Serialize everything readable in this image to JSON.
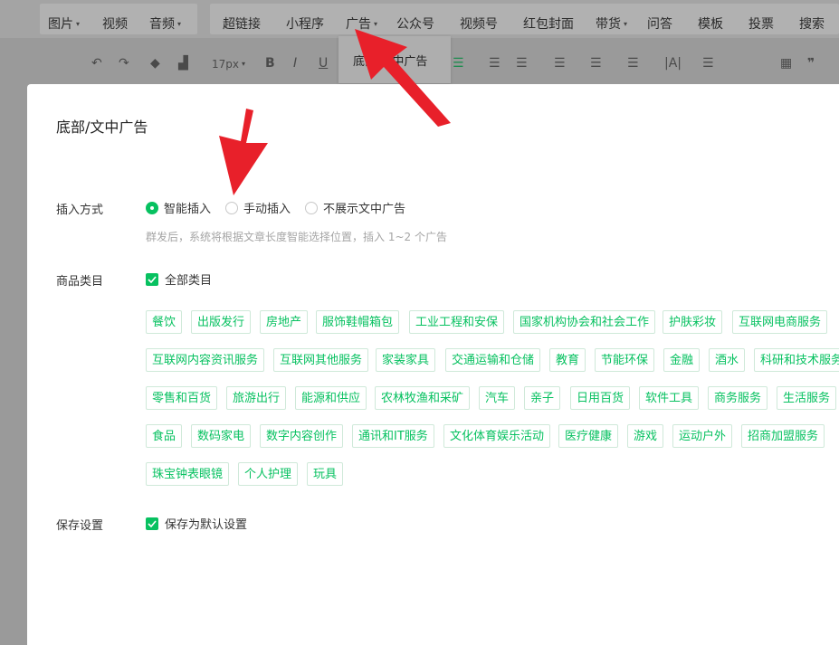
{
  "menubar": {
    "left_items": [
      {
        "label": "图片",
        "caret": true
      },
      {
        "label": "视频",
        "caret": false
      },
      {
        "label": "音频",
        "caret": true
      }
    ],
    "right_items": [
      {
        "label": "超链接",
        "caret": false
      },
      {
        "label": "小程序",
        "caret": false
      },
      {
        "label": "广告",
        "caret": true
      },
      {
        "label": "公众号",
        "caret": false
      },
      {
        "label": "视频号",
        "caret": false
      },
      {
        "label": "红包封面",
        "caret": false
      },
      {
        "label": "带货",
        "caret": true
      },
      {
        "label": "问答",
        "caret": false
      },
      {
        "label": "模板",
        "caret": false
      },
      {
        "label": "投票",
        "caret": false
      },
      {
        "label": "搜索",
        "caret": false
      }
    ]
  },
  "dropdown": {
    "item": "底部/文中广告"
  },
  "toolbar": {
    "font_size": "17px"
  },
  "modal": {
    "title": "底部/文中广告",
    "insert_mode": {
      "label": "插入方式",
      "options": [
        "智能插入",
        "手动插入",
        "不展示文中广告"
      ],
      "selected": "智能插入",
      "hint": "群发后，系统将根据文章长度智能选择位置，插入 1~2 个广告"
    },
    "category": {
      "label": "商品类目",
      "all_label": "全部类目",
      "tags": [
        "餐饮",
        "出版发行",
        "房地产",
        "服饰鞋帽箱包",
        "工业工程和安保",
        "国家机构协会和社会工作",
        "护肤彩妆",
        "互联网电商服务",
        "互联网内容资讯服务",
        "互联网其他服务",
        "家装家具",
        "交通运输和仓储",
        "教育",
        "节能环保",
        "金融",
        "酒水",
        "科研和技术服务",
        "零售和百货",
        "旅游出行",
        "能源和供应",
        "农林牧渔和采矿",
        "汽车",
        "亲子",
        "日用百货",
        "软件工具",
        "商务服务",
        "生活服务",
        "食品",
        "数码家电",
        "数字内容创作",
        "通讯和IT服务",
        "文化体育娱乐活动",
        "医疗健康",
        "游戏",
        "运动户外",
        "招商加盟服务",
        "珠宝钟表眼镜",
        "个人护理",
        "玩具"
      ]
    },
    "save": {
      "label": "保存设置",
      "checkbox_label": "保存为默认设置"
    }
  },
  "colors": {
    "accent": "#07c160",
    "arrow": "#e8202a",
    "overlay": "#9a9a9a"
  }
}
